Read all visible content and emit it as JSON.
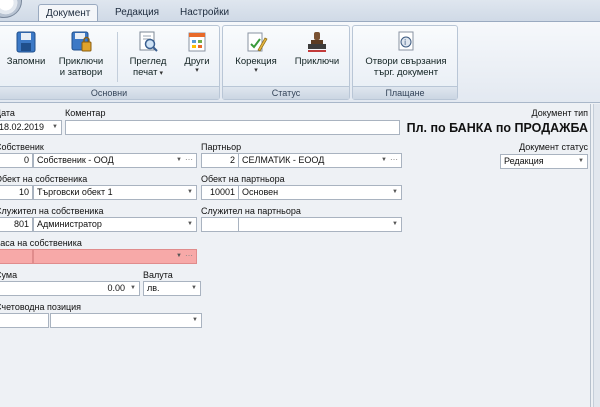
{
  "ribbon": {
    "tabs": [
      {
        "label": "Документ"
      },
      {
        "label": "Редакция"
      },
      {
        "label": "Настройки"
      }
    ],
    "groups": {
      "main": {
        "label": "Основни",
        "save": "Запомни",
        "accept_close_1": "Приключи",
        "accept_close_2": "и затвори",
        "preview_1": "Преглед",
        "preview_2": "печат",
        "other": "Други"
      },
      "status": {
        "label": "Статус",
        "correction": "Корекция",
        "finish": "Приключи"
      },
      "payment": {
        "label": "Плащане",
        "open_1": "Отвори свързания",
        "open_2": "търг. документ"
      }
    }
  },
  "form": {
    "date": {
      "label": "Дата",
      "value": "18.02.2019"
    },
    "comment": {
      "label": "Коментар",
      "value": ""
    },
    "doc_type": {
      "label": "Документ тип",
      "value": "Пл. по БАНКА по ПРОДАЖБА"
    },
    "doc_status": {
      "label": "Документ статус",
      "value": "Редакция"
    },
    "owner": {
      "label": "Собственик",
      "code": "0",
      "name": "Собственик - ООД"
    },
    "partner": {
      "label": "Партньор",
      "code": "2",
      "name": "СЕЛМАТИК - ЕООД"
    },
    "owner_object": {
      "label": "Обект на собственика",
      "code": "10",
      "name": "Търговски обект 1"
    },
    "partner_object": {
      "label": "Обект на партньора",
      "code": "10001",
      "name": "Основен"
    },
    "owner_employee": {
      "label": "Служител на собственика",
      "code": "801",
      "name": "Администратор"
    },
    "partner_employee": {
      "label": "Служител на партньора",
      "code": "",
      "name": ""
    },
    "owner_cash": {
      "label": "Каса на собственика",
      "code": "",
      "name": ""
    },
    "amount": {
      "label": "Сума",
      "value": "0.00"
    },
    "currency": {
      "label": "Валута",
      "value": "лв."
    },
    "accounting": {
      "label": "Счетоводна позиция",
      "code": "",
      "name": ""
    }
  },
  "colors": {
    "required_field": "#f7a9a8",
    "ribbon_bg": "#e3e9f1"
  }
}
